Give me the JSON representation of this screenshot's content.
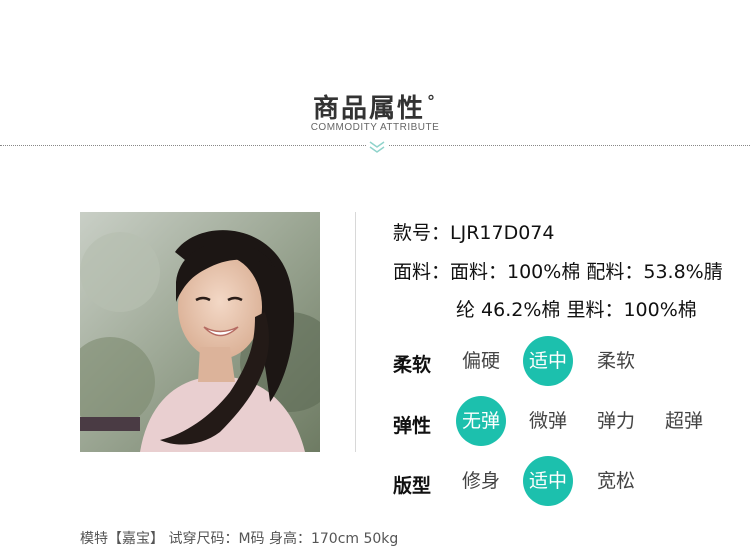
{
  "header": {
    "title": "商品属性",
    "degree": "°",
    "subtitle": "COMMODITY ATTRIBUTE"
  },
  "info": {
    "style_no": "款号：LJR17D074",
    "fabric_line1": "面料：面料：100%棉 配料：53.8%腈",
    "fabric_line2": "纶 46.2%棉 里料：100%棉"
  },
  "attributes": {
    "softness": {
      "label": "柔软",
      "options": [
        "偏硬",
        "适中",
        "柔软"
      ],
      "selected": "适中"
    },
    "elasticity": {
      "label": "弹性",
      "options": [
        "无弹",
        "微弹",
        "弹力",
        "超弹"
      ],
      "selected": "无弹"
    },
    "fit": {
      "label": "版型",
      "options": [
        "修身",
        "适中",
        "宽松"
      ],
      "selected": "适中"
    }
  },
  "footer": {
    "model_info": "模特【嘉宝】 试穿尺码：M码 身高：170cm 50kg"
  },
  "colors": {
    "accent": "#1cc0ad",
    "chevron": "#8fd3cb"
  }
}
